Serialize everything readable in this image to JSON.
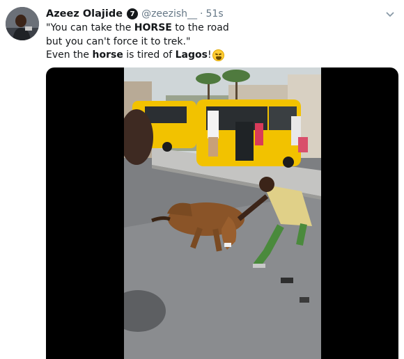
{
  "tweet": {
    "author_name": "Azeez Olajide",
    "verified_badge": "7",
    "handle": "@zeezish__",
    "separator": "·",
    "time": "51s",
    "text_line1_a": "\"You can take the ",
    "text_line1_b": "HORSE",
    "text_line1_c": " to the road",
    "text_line2": "but you can't force it to trek.\"",
    "text_line3_a": "Even the ",
    "text_line3_b": "horse",
    "text_line3_c": " is tired of ",
    "text_line3_d": "Lagos",
    "text_line3_e": "!"
  },
  "icons": {
    "more": "chevron-down-icon",
    "emoji": "weary-face-emoji"
  },
  "colors": {
    "name": "#14171a",
    "secondary_text": "#657786",
    "media_background": "#000000",
    "taxi_yellow": "#f2c200"
  }
}
